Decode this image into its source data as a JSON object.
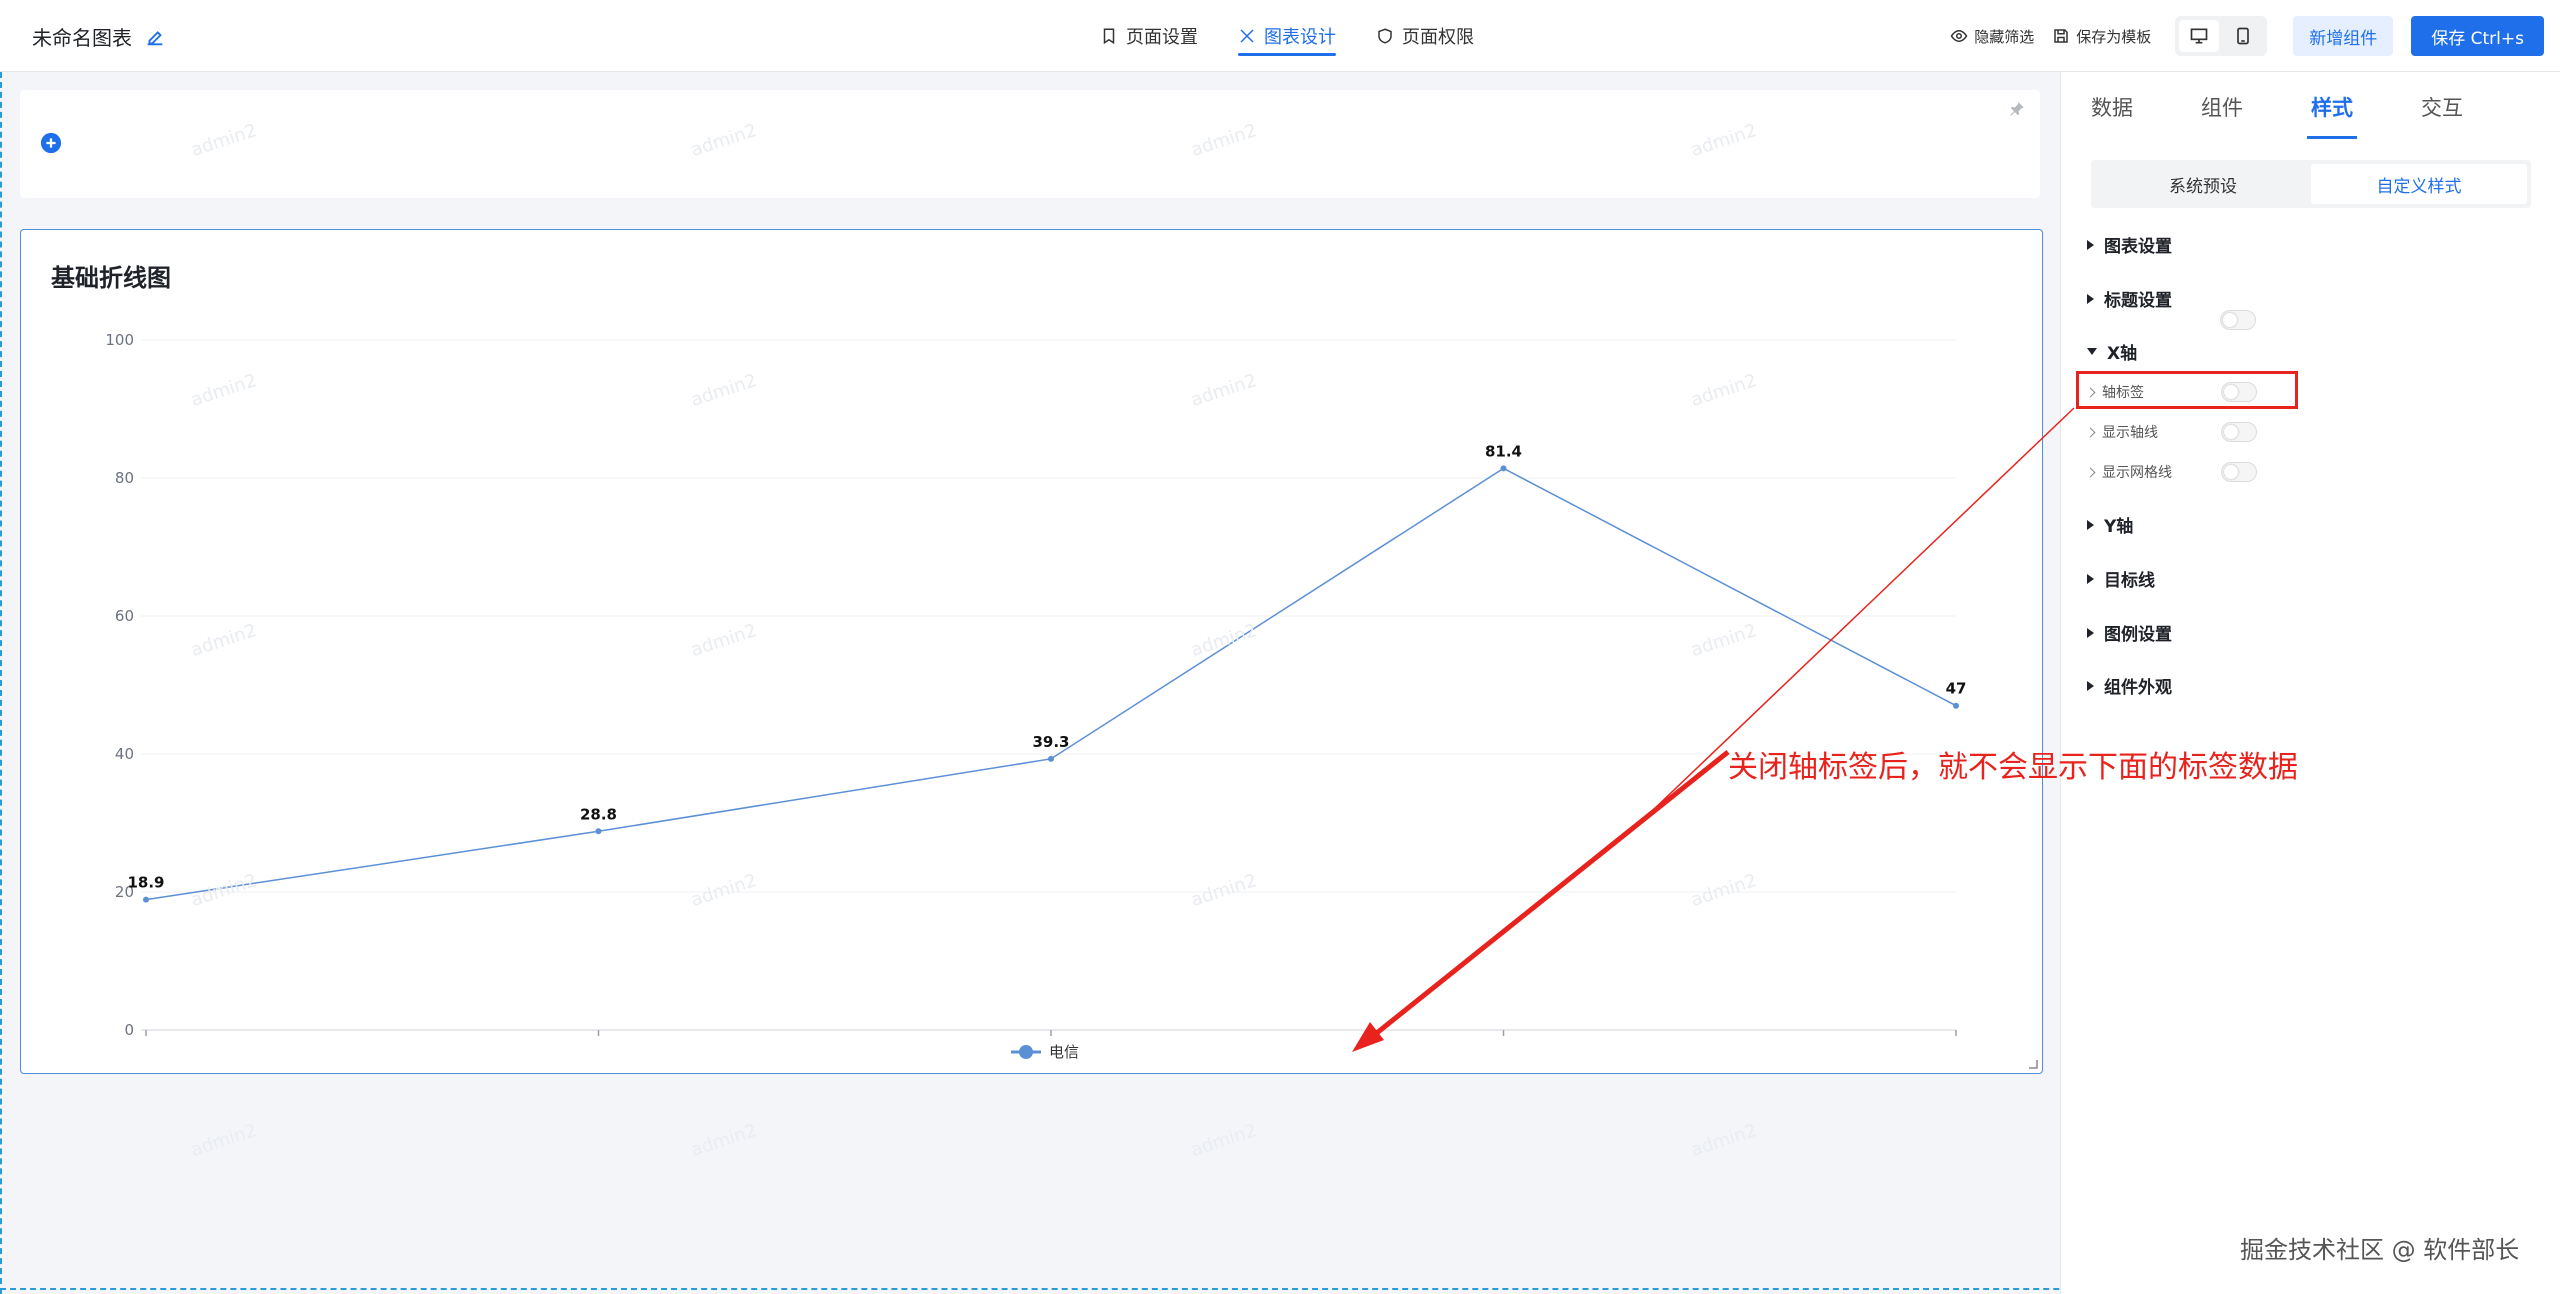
{
  "header": {
    "app_title": "未命名图表",
    "tabs": [
      {
        "label": "页面设置"
      },
      {
        "label": "图表设计"
      },
      {
        "label": "页面权限"
      }
    ],
    "actions": {
      "hide_filter": "隐藏筛选",
      "save_template": "保存为模板",
      "add_component": "新增组件",
      "save": "保存 Ctrl+s"
    }
  },
  "watermark_text": "admin2",
  "chart_title": "基础折线图",
  "chart_data": {
    "type": "line",
    "title": "",
    "xlabel": "",
    "ylabel": "",
    "x": [
      "",
      "",
      "",
      "",
      ""
    ],
    "ylim": [
      0,
      100
    ],
    "yticks": [
      0,
      20,
      40,
      60,
      80,
      100
    ],
    "grid": true,
    "legend_position": "bottom",
    "series": [
      {
        "name": "电信",
        "values": [
          18.9,
          28.8,
          39.3,
          81.4,
          47
        ],
        "color": "#5b8fd6"
      }
    ]
  },
  "panel": {
    "tabs": [
      {
        "label": "数据"
      },
      {
        "label": "组件"
      },
      {
        "label": "样式"
      },
      {
        "label": "交互"
      }
    ],
    "segments": [
      {
        "label": "系统预设"
      },
      {
        "label": "自定义样式"
      }
    ],
    "sections": {
      "chart_settings": "图表设置",
      "title_settings": "标题设置",
      "x_axis": "X轴",
      "axis_label": "轴标签",
      "show_axis_line": "显示轴线",
      "show_grid_line": "显示网格线",
      "y_axis": "Y轴",
      "target_line": "目标线",
      "legend_settings": "图例设置",
      "component_appearance": "组件外观"
    }
  },
  "annotation_text": "关闭轴标签后，就不会显示下面的标签数据",
  "credit_text": "掘金技术社区 @ 软件部长",
  "colors": {
    "accent": "#1f6feb",
    "annotation": "#e8221c",
    "line": "#5b8fd6"
  }
}
